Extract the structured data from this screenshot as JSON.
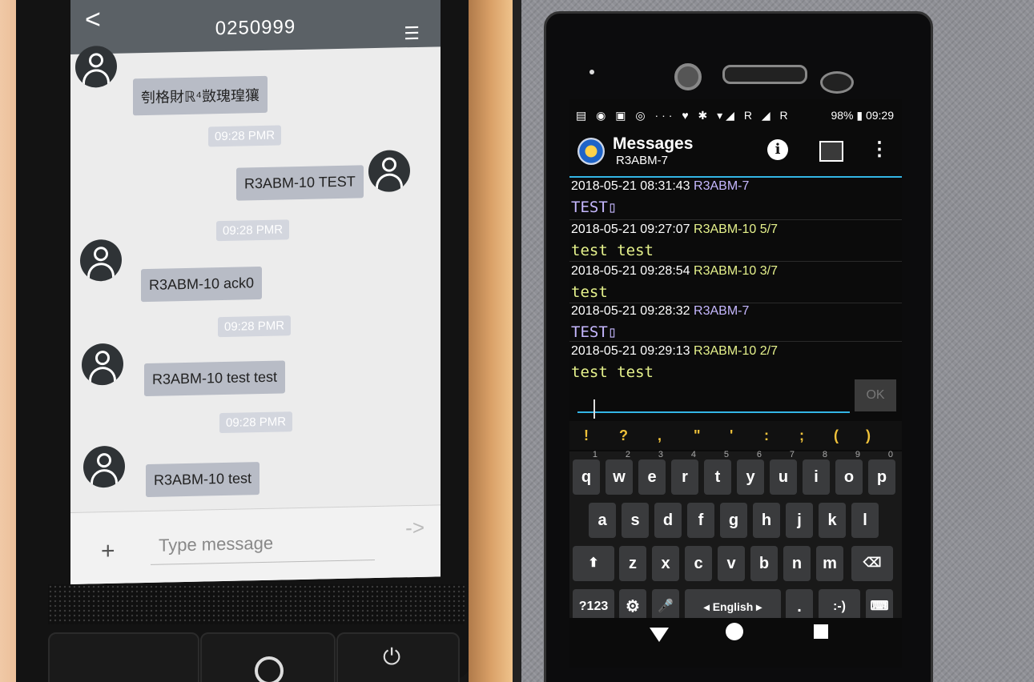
{
  "left": {
    "header": {
      "back": "<",
      "title": "0250999",
      "menu": "☰"
    },
    "messages": [
      {
        "kind": "in",
        "text": "刳格財ℝ⁴敳瑰瑝獽"
      },
      {
        "kind": "time",
        "text": "09:28 PMR"
      },
      {
        "kind": "out",
        "text": "R3ABM-10 TEST"
      },
      {
        "kind": "time",
        "text": "09:28 PMR"
      },
      {
        "kind": "in",
        "text": "R3ABM-10 ack0"
      },
      {
        "kind": "time",
        "text": "09:28 PMR"
      },
      {
        "kind": "in",
        "text": "R3ABM-10 test test"
      },
      {
        "kind": "time",
        "text": "09:28 PMR"
      },
      {
        "kind": "in",
        "text": "R3ABM-10 test"
      }
    ],
    "input": {
      "plus": "+",
      "placeholder": "Type message",
      "send": "->"
    }
  },
  "right": {
    "status": {
      "icons": "▤ ◉ ▣ ◎ ··· ♥ ✱ ▾◢ R ◢ R",
      "battery": "98%",
      "time": "09:29"
    },
    "appbar": {
      "title": "Messages",
      "subtitle": "R3ABM-7",
      "info": "i",
      "more": "⋮"
    },
    "messages": [
      {
        "date": "2018-05-21 08:31:43",
        "call": "R3ABM-7",
        "color": "#c6b8ff",
        "body": "TEST▯",
        "body_color": "#c6b8ff"
      },
      {
        "date": "2018-05-21 09:27:07",
        "call": "R3ABM-10 5/7",
        "color": "#e6f28c",
        "body": "test test",
        "body_color": "#e6f28c"
      },
      {
        "date": "2018-05-21 09:28:54",
        "call": "R3ABM-10 3/7",
        "color": "#e6f28c",
        "body": "test",
        "body_color": "#e6f28c"
      },
      {
        "date": "2018-05-21 09:28:32",
        "call": "R3ABM-7",
        "color": "#c6b8ff",
        "body": "TEST▯",
        "body_color": "#c6b8ff"
      },
      {
        "date": "2018-05-21 09:29:13",
        "call": "R3ABM-10 2/7",
        "color": "#e6f28c",
        "body": "test test",
        "body_color": "#e6f28c"
      }
    ],
    "ok_label": "OK",
    "suggestions": [
      "!",
      "?",
      ",",
      "\"",
      "'",
      ":",
      ";",
      "(",
      ")"
    ],
    "keyboard": {
      "row1": [
        {
          "k": "q",
          "n": "1"
        },
        {
          "k": "w",
          "n": "2"
        },
        {
          "k": "e",
          "n": "3"
        },
        {
          "k": "r",
          "n": "4"
        },
        {
          "k": "t",
          "n": "5"
        },
        {
          "k": "y",
          "n": "6"
        },
        {
          "k": "u",
          "n": "7"
        },
        {
          "k": "i",
          "n": "8"
        },
        {
          "k": "o",
          "n": "9"
        },
        {
          "k": "p",
          "n": "0"
        }
      ],
      "row2": [
        "a",
        "s",
        "d",
        "f",
        "g",
        "h",
        "j",
        "k",
        "l"
      ],
      "row3": [
        "z",
        "x",
        "c",
        "v",
        "b",
        "n",
        "m"
      ],
      "shift": "⬆",
      "backspace": "⌫",
      "sym": "?123",
      "settings": "⚙",
      "mic": "🎤",
      "space": "◂ English ▸",
      "period": ".",
      "smiley": ":-)",
      "kbd": "⌨"
    }
  }
}
